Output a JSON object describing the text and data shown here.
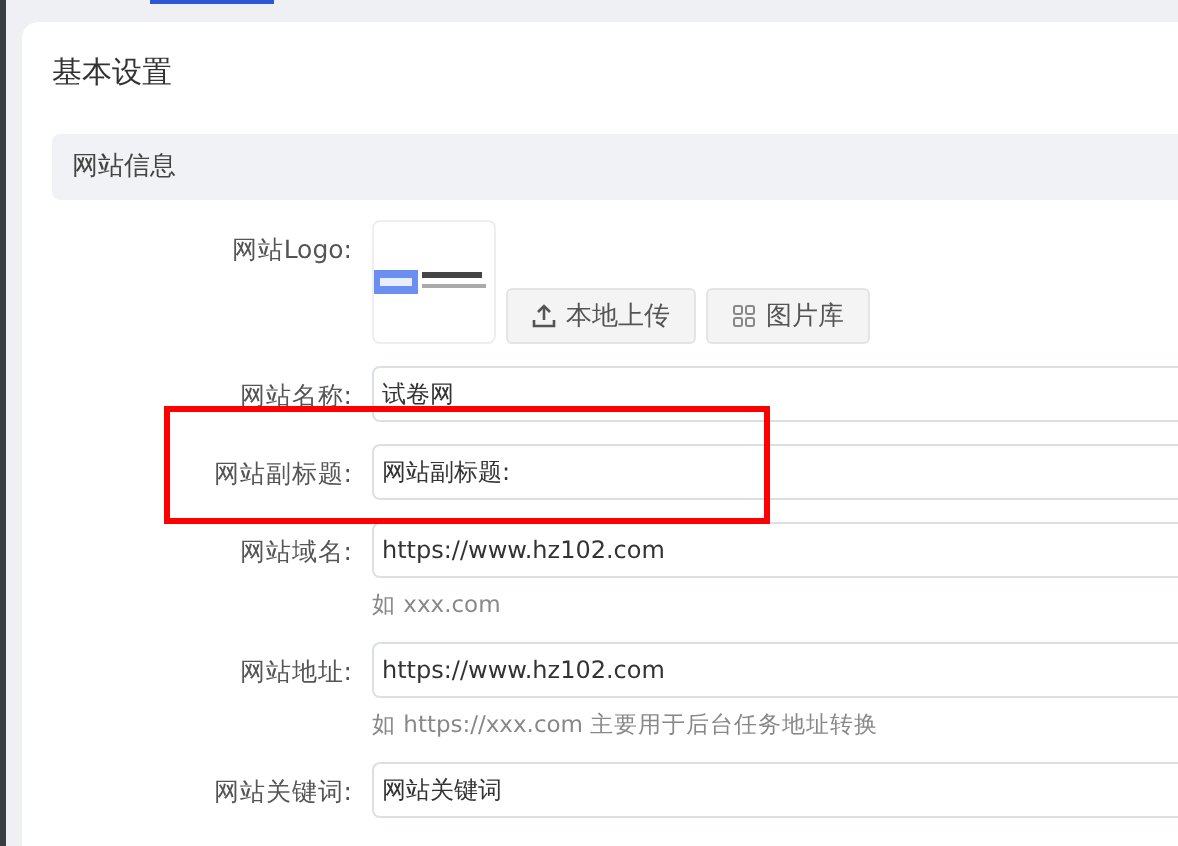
{
  "card": {
    "title": "基本设置"
  },
  "section": {
    "title": "网站信息"
  },
  "fields": [
    {
      "kind": "logo",
      "label": "网站Logo:",
      "highlighted": false,
      "buttons": [
        {
          "label": "本地上传"
        },
        {
          "label": "图片库"
        }
      ]
    },
    {
      "kind": "text",
      "label": "网站名称:",
      "value": "试卷网",
      "highlighted": false
    },
    {
      "kind": "text",
      "label": "网站副标题:",
      "value": "网站副标题:",
      "highlighted": true
    },
    {
      "kind": "text",
      "label": "网站域名:",
      "value": "https://www.hz102.com",
      "hint": "如 xxx.com",
      "highlighted": false
    },
    {
      "kind": "text",
      "label": "网站地址:",
      "value": "https://www.hz102.com",
      "hint": "如 https://xxx.com 主要用于后台任务地址转换",
      "highlighted": false
    },
    {
      "kind": "text",
      "label": "网站关键词:",
      "value": "网站关键词",
      "highlighted": false
    }
  ]
}
